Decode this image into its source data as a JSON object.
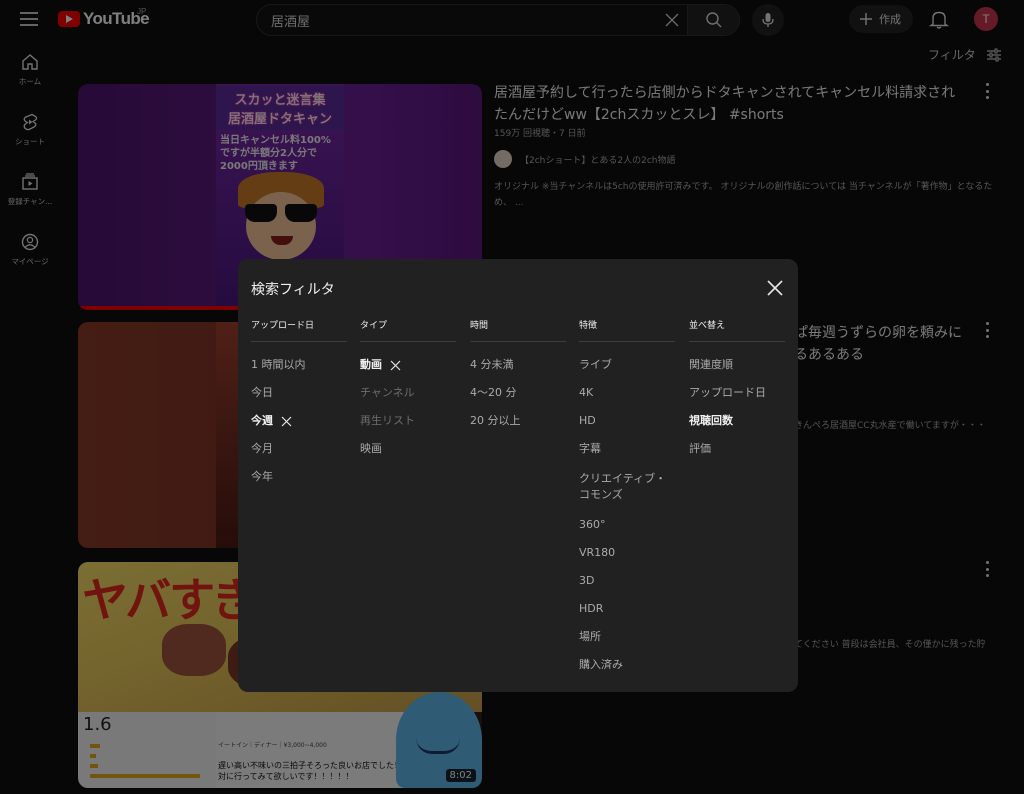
{
  "header": {
    "logo_text": "YouTube",
    "logo_region": "JP",
    "search_value": "居酒屋",
    "create_label": "作成",
    "avatar_letter": "T"
  },
  "filter_toggle_label": "フィルタ",
  "sidebar": {
    "items": [
      {
        "icon": "home-icon",
        "label": "ホーム"
      },
      {
        "icon": "shorts-icon",
        "label": "ショート"
      },
      {
        "icon": "subscriptions-icon",
        "label": "登録チャン..."
      },
      {
        "icon": "account-icon",
        "label": "マイページ"
      }
    ]
  },
  "results": [
    {
      "thumb_head": [
        "スカッと迷言集",
        "居酒屋ドタキャン"
      ],
      "thumb_sub": "当日キャンセル料100%ですが半額分2人分で2000円頂きます",
      "title": "居酒屋予約して行ったら店側からドタキャンされてキャンセル料請求されたんだけどww【2chスカッとスレ】 #shorts",
      "meta": "159万 回視聴・7 日前",
      "channel": "【2chショート】とある2人の2ch物語",
      "desc": "オリジナル ※当チャンネルは5chの使用許可済みです。 オリジナルの創作話については 当チャンネルが「著作物」となるため、 ..."
    },
    {
      "title_visible_tail_1": "ぱ毎週うずらの卵を頼みに",
      "title_visible_tail_2": "るあるある",
      "desc_tail": "きんぺろ居酒屋CC丸水産で働いてますが・・・"
    },
    {
      "thumb_big": "ヤバすぎ",
      "rating": "1.6",
      "card_line": "イートイン｜ディナー｜¥3,000~4,000",
      "card_text": "遅い高い不味いの三拍子そろった良いお店でした！絶対に行ってみて欲しいです！！！！！",
      "duration": "8:02",
      "desc_tail": "てください 普段は会社員、その僅かに残った貯"
    }
  ],
  "dialog": {
    "title": "検索フィルタ",
    "columns": [
      {
        "header": "アップロード日",
        "options": [
          "1 時間以内",
          "今日",
          "今週",
          "今月",
          "今年"
        ]
      },
      {
        "header": "タイプ",
        "options": [
          "動画",
          "チャンネル",
          "再生リスト",
          "映画"
        ]
      },
      {
        "header": "時間",
        "options": [
          "4 分未満",
          "4～20 分",
          "20 分以上"
        ]
      },
      {
        "header": "特徴",
        "options": [
          "ライブ",
          "4K",
          "HD",
          "字幕",
          "クリエイティブ・コモンズ",
          "360°",
          "VR180",
          "3D",
          "HDR",
          "場所",
          "購入済み"
        ]
      },
      {
        "header": "並べ替え",
        "options": [
          "関連度順",
          "アップロード日",
          "視聴回数",
          "評価"
        ]
      }
    ]
  }
}
